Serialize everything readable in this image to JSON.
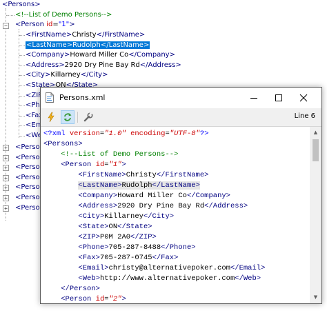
{
  "tree": {
    "root_label": "<Persons>",
    "comment": "<!--List of Demo Persons-->",
    "person1": {
      "open": "<Person ",
      "attr_name": "id",
      "attr_eq": "=",
      "attr_value": "\"1\"",
      "close": ">"
    },
    "children": [
      {
        "open": "<FirstName>",
        "text": "Christy",
        "close": "</FirstName>"
      },
      {
        "open": "<LastName>",
        "text": "Rudolph",
        "close": "</LastName>",
        "selected": true
      },
      {
        "open": "<Company>",
        "text": "Howard Miller Co",
        "close": "</Company>"
      },
      {
        "open": "<Address>",
        "text": "2920 Dry Pine Bay Rd",
        "close": "</Address>"
      },
      {
        "open": "<City>",
        "text": "Killarney",
        "close": "</City>"
      },
      {
        "open": "<State>",
        "text": "ON",
        "close": "</State>"
      },
      {
        "open": "<ZIP",
        "text": "",
        "close": ""
      },
      {
        "open": "<Pho",
        "text": "",
        "close": ""
      },
      {
        "open": "<Fax",
        "text": "",
        "close": ""
      },
      {
        "open": "<Ema",
        "text": "",
        "close": ""
      },
      {
        "open": "<Web",
        "text": "",
        "close": ""
      }
    ],
    "collapsed_persons": [
      "<Person",
      "<Person",
      "<Person",
      "<Person",
      "<Person",
      "<Person",
      "<Person"
    ]
  },
  "window": {
    "title": "Persons.xml",
    "line_indicator": "Line 6",
    "icons": {
      "file": "xml-file-icon",
      "tool1": "lightning-icon",
      "tool2": "refresh-icon",
      "tool3": "wrench-icon"
    }
  },
  "editor": {
    "decl": {
      "open": "<?xml ",
      "version_name": "version",
      "version_value": "\"1.0\"",
      "encoding_name": "encoding",
      "encoding_value": "\"UTF-8\"",
      "close": "?>"
    },
    "root_open": "<Persons>",
    "comment": "<!--List of Demo Persons-->",
    "person1_open": {
      "open": "<Person ",
      "attr_name": "id",
      "attr_value": "\"1\"",
      "close": ">"
    },
    "fields": [
      {
        "open": "<FirstName>",
        "text": "Christy",
        "close": "</FirstName>"
      },
      {
        "open": "<LastName>",
        "text": "Rudolph",
        "close": "</LastName>",
        "highlight": true
      },
      {
        "open": "<Company>",
        "text": "Howard Miller Co",
        "close": "</Company>"
      },
      {
        "open": "<Address>",
        "text": "2920 Dry Pine Bay Rd",
        "close": "</Address>"
      },
      {
        "open": "<City>",
        "text": "Killarney",
        "close": "</City>"
      },
      {
        "open": "<State>",
        "text": "ON",
        "close": "</State>"
      },
      {
        "open": "<ZIP>",
        "text": "P0M 2A0",
        "close": "</ZIP>"
      },
      {
        "open": "<Phone>",
        "text": "705-287-8488",
        "close": "</Phone>"
      },
      {
        "open": "<Fax>",
        "text": "705-287-0745",
        "close": "</Fax>"
      },
      {
        "open": "<Email>",
        "text": "christy@alternativepoker.com",
        "close": "</Email>"
      },
      {
        "open": "<Web>",
        "text": "http://www.alternativepoker.com",
        "close": "</Web>"
      }
    ],
    "person1_close": "</Person>",
    "person2_open": {
      "open": "<Person ",
      "attr_name": "id",
      "attr_value": "\"2\"",
      "close": ">"
    }
  },
  "colors": {
    "tag": "#000080",
    "comment": "#008000",
    "attr_name": "#cc0000",
    "selection": "#0078d7",
    "pi": "#0000ff"
  }
}
